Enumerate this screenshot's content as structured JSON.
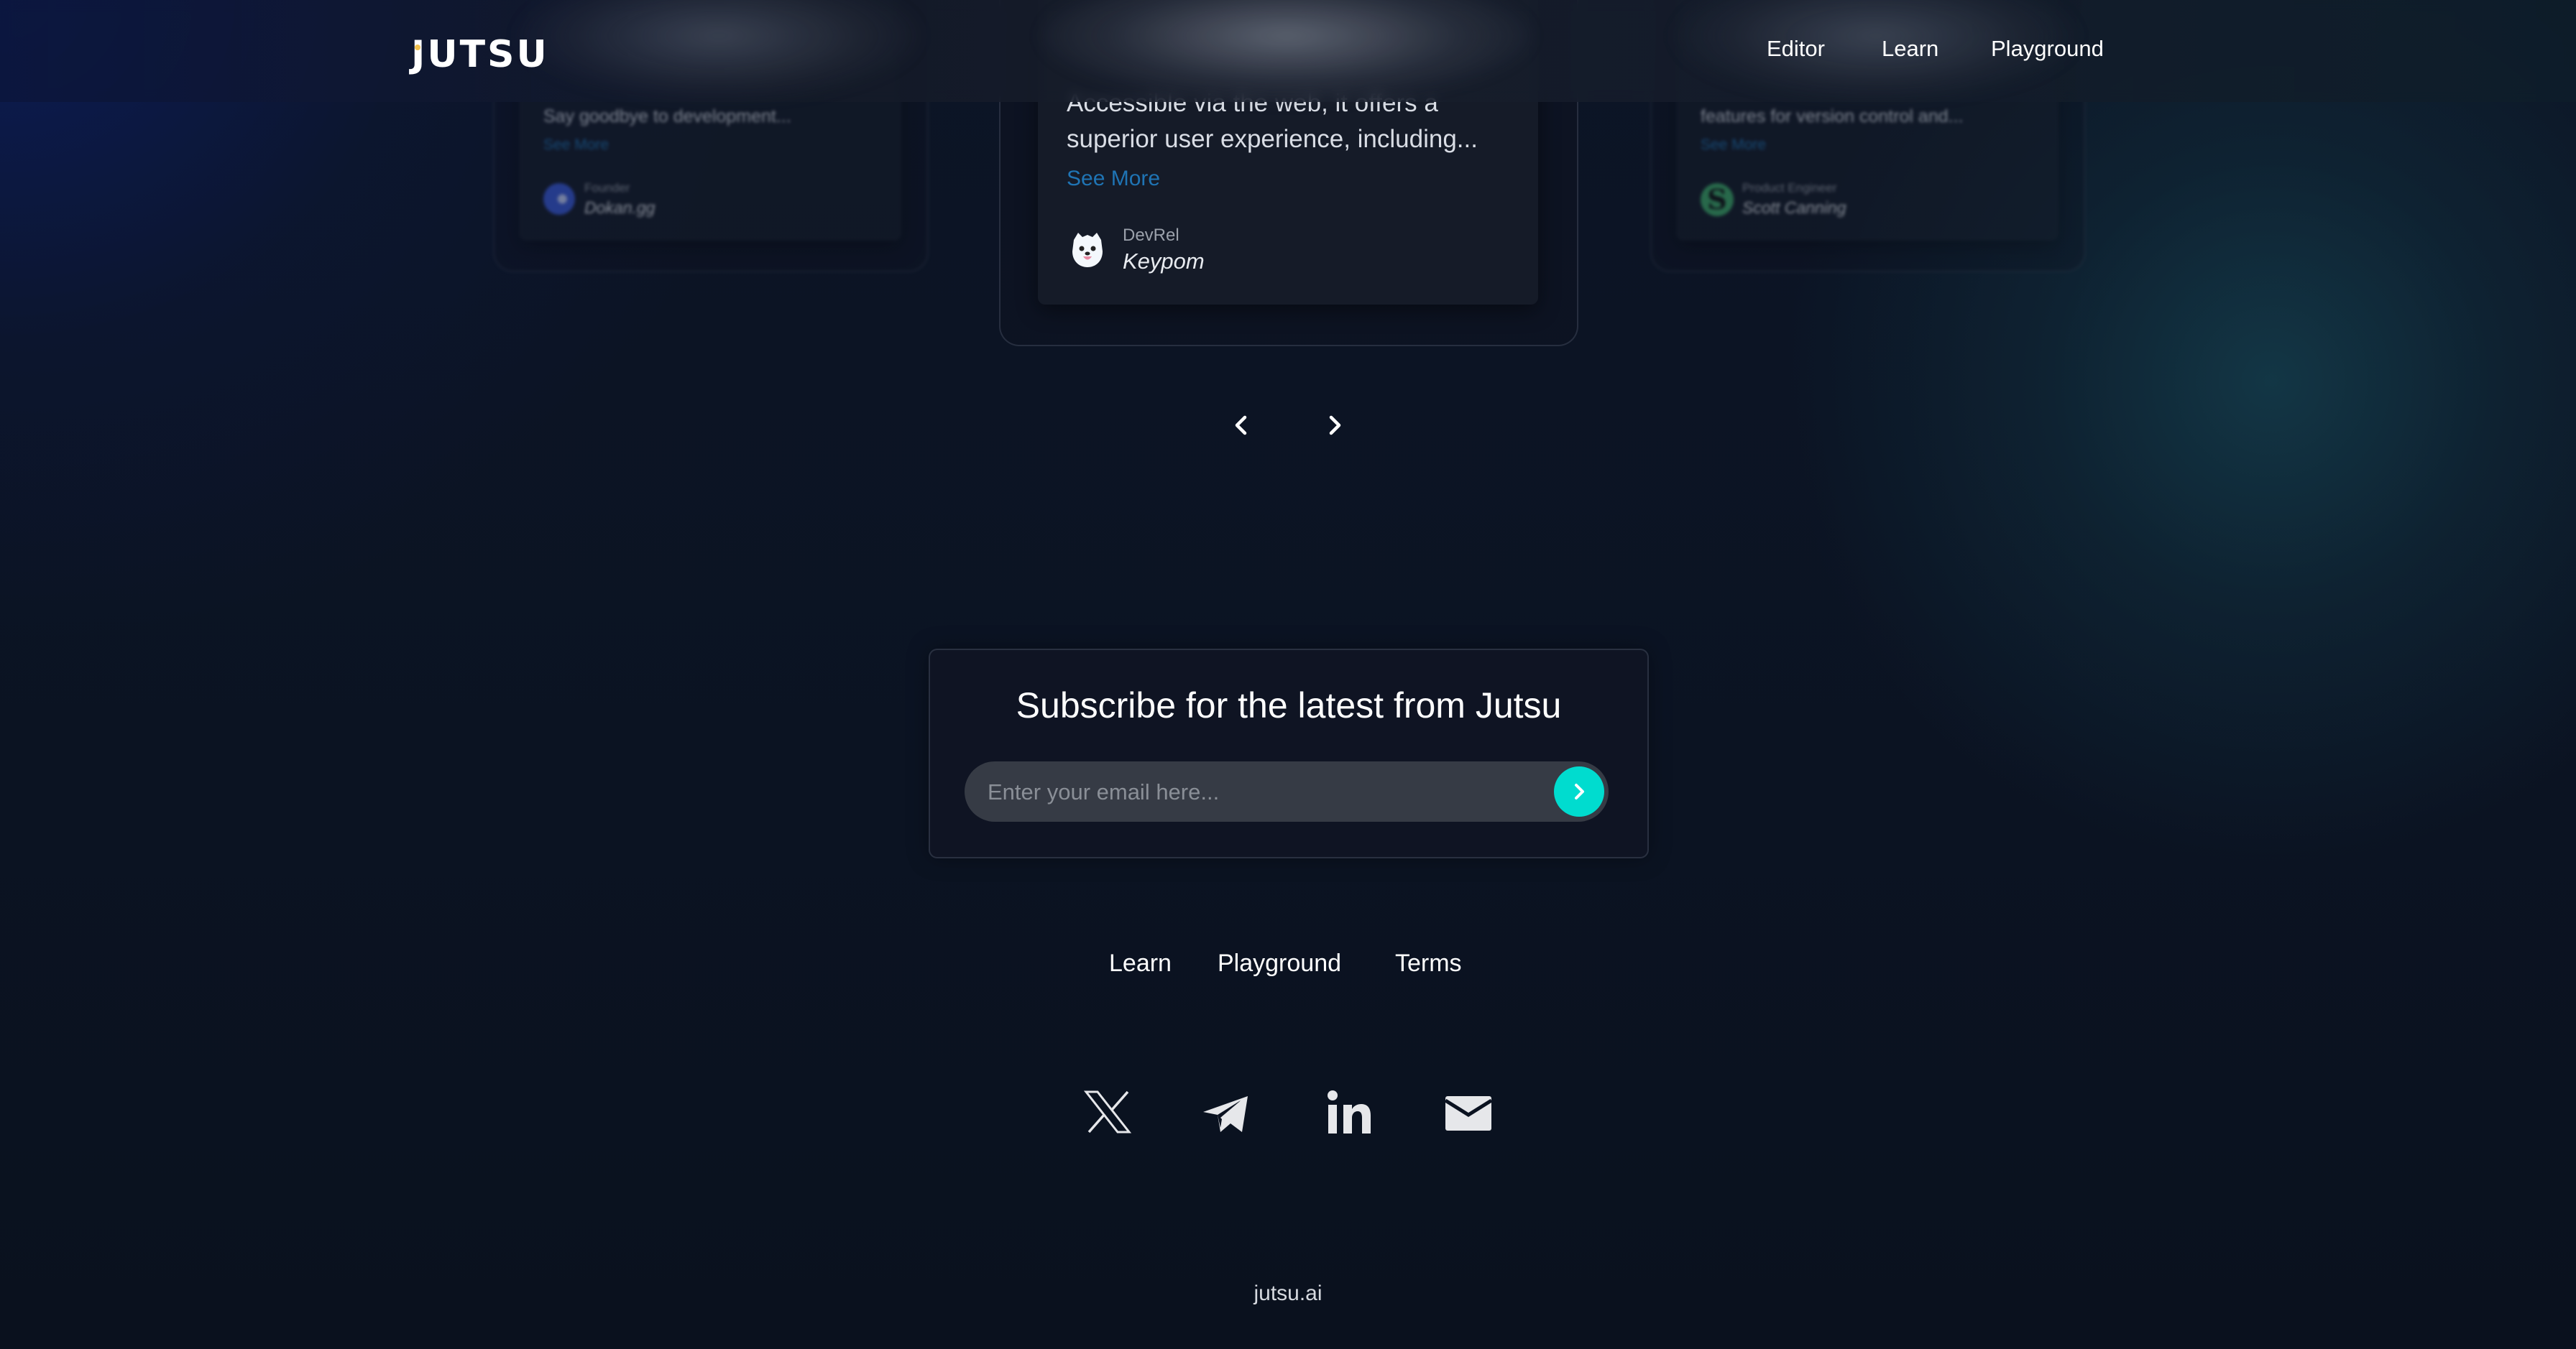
{
  "header": {
    "logo": "JUTSU",
    "nav": [
      {
        "label": "Editor"
      },
      {
        "label": "Learn"
      },
      {
        "label": "Playground"
      }
    ]
  },
  "testimonials": {
    "cards": [
      {
        "position": "left",
        "text_lines": [
          "Say goodbye to development..."
        ],
        "see_more": "See More",
        "role": "Founder",
        "name": "Dokan.gg",
        "avatar": "dokan-logo"
      },
      {
        "position": "center",
        "text_lines": [
          "Accessible via the web, it offers a",
          "superior user experience, including..."
        ],
        "see_more": "See More",
        "role": "DevRel",
        "name": "Keypom",
        "avatar": "keypom-dog-logo"
      },
      {
        "position": "right",
        "text_lines": [
          "features for version control and..."
        ],
        "see_more": "See More",
        "role": "Product Engineer",
        "name": "Scott Canning",
        "avatar": "s-initial-logo"
      }
    ],
    "prev_icon": "chevron-left-icon",
    "next_icon": "chevron-right-icon"
  },
  "subscribe": {
    "title": "Subscribe for the latest from Jutsu",
    "email_value": "",
    "email_placeholder": "Enter your email here...",
    "submit_icon": "chevron-right-icon",
    "accent": "#00dccf"
  },
  "footer": {
    "links": [
      {
        "label": "Learn"
      },
      {
        "label": "Playground"
      },
      {
        "label": "Terms"
      }
    ],
    "social": [
      {
        "name": "x-icon"
      },
      {
        "name": "telegram-icon"
      },
      {
        "name": "linkedin-icon"
      },
      {
        "name": "email-icon"
      }
    ],
    "domain": "jutsu.ai"
  },
  "colors": {
    "link_blue": "#1f74b4",
    "background": "#0b1220"
  }
}
